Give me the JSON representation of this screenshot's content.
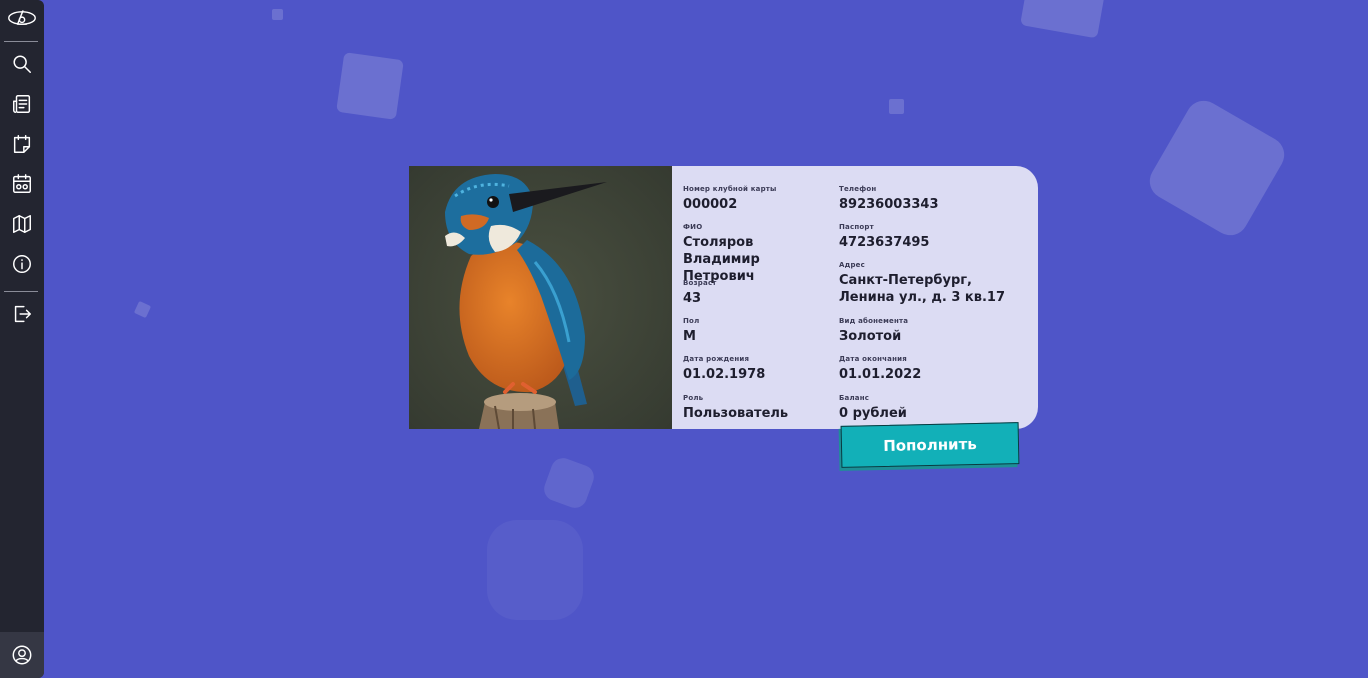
{
  "sidebar": {
    "items": [
      {
        "icon": "logo-icon"
      },
      {
        "icon": "search-icon"
      },
      {
        "icon": "news-icon"
      },
      {
        "icon": "notes-icon"
      },
      {
        "icon": "schedule-icon"
      },
      {
        "icon": "map-icon"
      },
      {
        "icon": "info-icon"
      },
      {
        "icon": "logout-icon"
      }
    ],
    "profile_icon": "user-profile-icon"
  },
  "card": {
    "card_number": {
      "label": "Номер клубной карты",
      "value": "000002"
    },
    "name": {
      "label": "ФИО",
      "value": "Столяров Владимир Петрович"
    },
    "age": {
      "label": "Возраст",
      "value": "43"
    },
    "sex": {
      "label": "Пол",
      "value": "М"
    },
    "birth_date": {
      "label": "Дата рождения",
      "value": "01.02.1978"
    },
    "role": {
      "label": "Роль",
      "value": "Пользователь"
    },
    "phone": {
      "label": "Телефон",
      "value": "89236003343"
    },
    "passport": {
      "label": "Паспорт",
      "value": "4723637495"
    },
    "address": {
      "label": "Адрес",
      "value": "Санкт-Петербург, Ленина ул., д. 3 кв.17"
    },
    "membership": {
      "label": "Вид абонемента",
      "value": "Золотой"
    },
    "end_date": {
      "label": "Дата окончания",
      "value": "01.01.2022"
    },
    "balance": {
      "label": "Баланс",
      "value": "0 рублей"
    }
  },
  "top_up_button": "Пополнить",
  "colors": {
    "background": "#4f55c8",
    "sidebar": "#232530",
    "card": "#dcdcf3",
    "button": "#12b0b8"
  }
}
